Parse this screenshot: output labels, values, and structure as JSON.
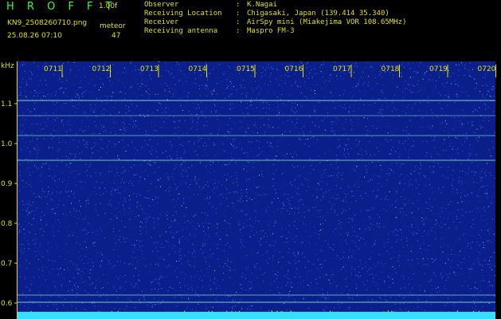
{
  "header": {
    "app_title": "H R O F F T",
    "version": "1.00f",
    "filename": "KN9_2508260710.png",
    "meteor_label": "meteor",
    "datetime": "25.08.26 07:10",
    "meteor_count": "47"
  },
  "station_info": [
    {
      "label": "Observer",
      "value": "K.Nagai"
    },
    {
      "label": "Receiving Location",
      "value": "Chigasaki, Japan (139.414 35.340)"
    },
    {
      "label": "Receiver",
      "value": "AirSpy mini (Miakejima VOR 108.65MHz)"
    },
    {
      "label": "Receiving antenna",
      "value": "Maspro FM-3"
    }
  ],
  "spectrogram": {
    "y_unit": "kHz",
    "y_ticks": [
      "1.1",
      "1.0",
      "0.9",
      "0.8",
      "0.7",
      "0.6"
    ],
    "time_labels": [
      "0711",
      "0712",
      "0713",
      "0714",
      "0715",
      "0716",
      "0717",
      "0718",
      "0719",
      "0720"
    ],
    "colors": {
      "background": "#0b1f8a",
      "noise": "#2a52e0",
      "carrier": "#7fe0d0",
      "axis": "#e0e000",
      "baseline": "#33e0ff"
    }
  }
}
